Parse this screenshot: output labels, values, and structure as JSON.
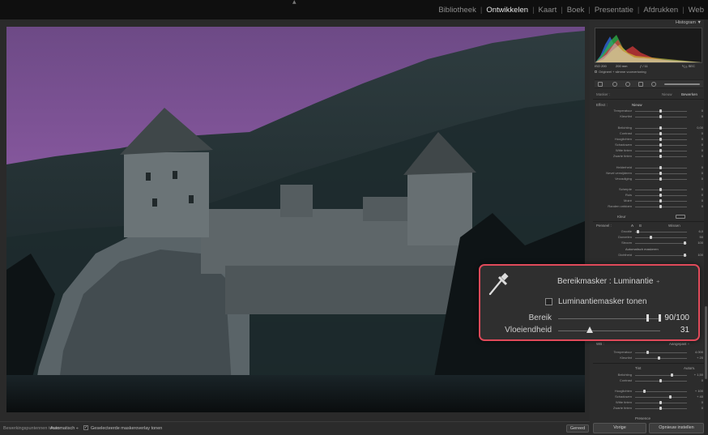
{
  "topbar": {
    "modules": [
      {
        "label": "Bibliotheek",
        "active": false
      },
      {
        "label": "Ontwikkelen",
        "active": true
      },
      {
        "label": "Kaart",
        "active": false
      },
      {
        "label": "Boek",
        "active": false
      },
      {
        "label": "Presentatie",
        "active": false
      },
      {
        "label": "Afdrukken",
        "active": false
      },
      {
        "label": "Web",
        "active": false
      }
    ]
  },
  "right_panel": {
    "histogram_title": "Histogram ▼",
    "hist_info": {
      "iso": "ISO 200",
      "focal": "200 mm",
      "aperture": "ƒ / 11",
      "shutter": "¹⁄₁₂₅ SEC"
    },
    "original_label": "Origineel + slimme voorvertoning",
    "mask_label": "Masker :",
    "mask_new": "Nieuw",
    "mask_edit": "Bewerken",
    "effect_label": "Effect :",
    "effect_value": "Nieuw",
    "sliders_group1": [
      {
        "label": "Temperatuur",
        "value": "0"
      },
      {
        "label": "Kleurtint",
        "value": "0"
      }
    ],
    "sliders_group2": [
      {
        "label": "Belichting",
        "value": "0,00"
      },
      {
        "label": "Contrast",
        "value": "0"
      },
      {
        "label": "Hooglichten",
        "value": "0"
      },
      {
        "label": "Schaduwen",
        "value": "0"
      },
      {
        "label": "Witte tinten",
        "value": "0"
      },
      {
        "label": "Zwarte tinten",
        "value": "0"
      }
    ],
    "sliders_group3": [
      {
        "label": "Helderheid",
        "value": "0"
      },
      {
        "label": "Nevel verwijderen",
        "value": "0"
      },
      {
        "label": "Verzadiging",
        "value": "0"
      }
    ],
    "sliders_group4": [
      {
        "label": "Scherpte",
        "value": "0"
      },
      {
        "label": "Ruis",
        "value": "0"
      },
      {
        "label": "Moiré",
        "value": "0"
      },
      {
        "label": "Randen ontdoen",
        "value": "0"
      }
    ],
    "color_label": "Kleur",
    "brush_label": "Penseel :",
    "brush_a": "A",
    "brush_b": "B",
    "brush_erase": "Wissen",
    "brush_sliders": [
      {
        "label": "Grootte",
        "value": "6,0"
      },
      {
        "label": "Doezelen",
        "value": "50"
      },
      {
        "label": "Stroom",
        "value": "100"
      }
    ],
    "auto_mask_label": "Automatisch maskeren",
    "density_label": "Dichtheid",
    "density_value": "100",
    "wb_label": "WB :",
    "wb_value": "Aangepast ÷",
    "wb_sliders": [
      {
        "label": "Temperatuur",
        "value": "4.000"
      },
      {
        "label": "Kleurtint",
        "value": "+ 20"
      }
    ],
    "tone_label": "Tint",
    "tone_auto": "Autom.",
    "tone_sliders": [
      {
        "label": "Belichting",
        "value": "+ 1,50"
      },
      {
        "label": "Contrast",
        "value": "0"
      }
    ],
    "tone_sliders2": [
      {
        "label": "Hooglichten",
        "value": "+ 100"
      },
      {
        "label": "Schaduwen",
        "value": "+ 40"
      },
      {
        "label": "Witte tinten",
        "value": "0"
      },
      {
        "label": "Zwarte tinten",
        "value": "0"
      }
    ],
    "presence_label": "Presence",
    "prev_button": "Vorige",
    "reset_button": "Opnieuw instellen"
  },
  "toolbar": {
    "overlay_label": "Bewerkingspuntennen tonen :",
    "overlay_value": "Automatisch ÷",
    "show_mask_checked": true,
    "show_mask_label": "Geselecteerde maskeroverlay tonen",
    "done_button": "Gereed"
  },
  "callout": {
    "title": "Bereikmasker : Luminantie",
    "updown": "÷",
    "check_label": "Luminantiemasker tonen",
    "check_checked": false,
    "range_label": "Bereik",
    "range_value": "90/100",
    "range_low": 0.9,
    "range_high": 1.0,
    "smooth_label": "Vloeiendheid",
    "smooth_value": "31",
    "smooth_fraction": 0.31
  }
}
